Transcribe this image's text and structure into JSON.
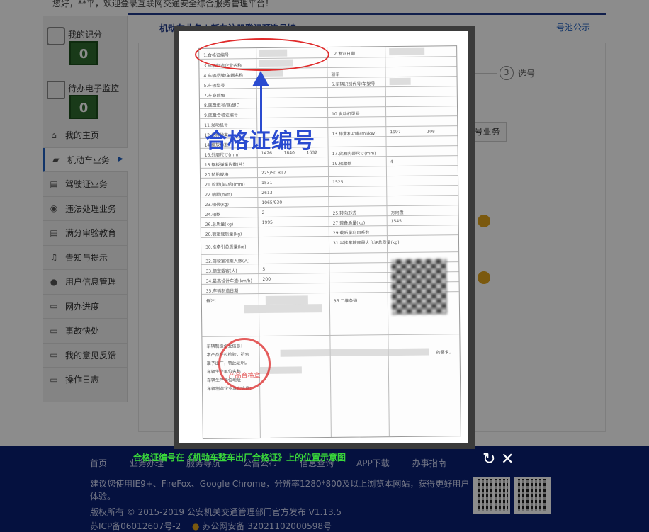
{
  "header": {
    "greeting": "您好，**平，欢迎登录互联网交通安全综合服务管理平台！"
  },
  "sidebar": {
    "stats": [
      {
        "label": "我的记分",
        "count": "0",
        "icon": "score-icon"
      },
      {
        "label": "待办电子监控",
        "count": "0",
        "icon": "camera-icon"
      }
    ],
    "items": [
      {
        "label": "我的主页",
        "icon": "home-icon"
      },
      {
        "label": "机动车业务",
        "icon": "truck-icon",
        "active": true
      },
      {
        "label": "驾驶证业务",
        "icon": "license-icon"
      },
      {
        "label": "违法处理业务",
        "icon": "camera-icon"
      },
      {
        "label": "满分审验教育",
        "icon": "list-icon"
      },
      {
        "label": "告知与提示",
        "icon": "bell-icon"
      },
      {
        "label": "用户信息管理",
        "icon": "user-icon"
      },
      {
        "label": "网办进度",
        "icon": "progress-icon"
      },
      {
        "label": "事故快处",
        "icon": "accident-icon"
      },
      {
        "label": "我的意见反馈",
        "icon": "feedback-icon"
      },
      {
        "label": "操作日志",
        "icon": "log-icon"
      }
    ]
  },
  "main": {
    "tab_title": "机动车业务 | 新车注册登记预选号牌",
    "tab_right": "号池公示",
    "step_num": "3",
    "step_label": "选号",
    "biz_button": "号业务"
  },
  "modal": {
    "callout": "合格证编号",
    "seal_text": "产品合格章",
    "caption": "合格证编号在《机动车整车出厂合格证》上的位置示意图",
    "doc_fields": {
      "f1": "1.合格证编号",
      "f2": "2.发证日期",
      "f3": "3.车辆制造企业名称",
      "f4": "4.车辆品牌/车辆名称",
      "f4v": "轿车",
      "f5": "5.车辆型号",
      "f6": "6.车辆识别代号/车架号",
      "f7": "7.车身颜色",
      "f8": "8.底盘型号/底盘ID",
      "f9": "9.底盘合格证编号",
      "f10": "10.发动机型号",
      "f11": "11.发动机号",
      "f12": "12.燃料种类",
      "f13": "13.排量和功率(ml/kW)",
      "f13v1": "1997",
      "f13v2": "108",
      "f14": "14.排放标准",
      "f16": "16.外廓尺寸(mm)",
      "f16v1": "1426",
      "f16v2": "1840",
      "f16v3": "1632",
      "f17": "17.货厢内部尺寸(mm)",
      "f18": "18.钢板弹簧片数(片)",
      "f19": "19.轮胎数",
      "f19v": "4",
      "f20": "20.轮胎规格",
      "f20v": "225/50 R17",
      "f21": "21.轮距(前/后)(mm)",
      "f21v1": "1531",
      "f21v2": "1525",
      "f22": "22.轴距(mm)",
      "f22v": "2613",
      "f23": "23.轴荷(kg)",
      "f23v": "1065/930",
      "f24": "24.轴数",
      "f24v": "2",
      "f25": "25.转向形式",
      "f25v": "方向盘",
      "f26": "26.总质量(kg)",
      "f26v": "1995",
      "f27": "27.整备质量(kg)",
      "f27v": "1545",
      "f28": "28.额定载质量(kg)",
      "f29": "29.载质量利用系数",
      "f30": "30.准牵引总质量(kg)",
      "f31": "31.半挂车鞍座最大允许总质量(kg)",
      "f32": "32.驾驶室准乘人数(人)",
      "f33": "33.额定载客(人)",
      "f33v": "5",
      "f34": "34.最高设计车速(km/h)",
      "f34v": "200",
      "f35": "35.车辆制造日期",
      "f36": "36.二维条码",
      "note": "备注：",
      "cert1": "车辆制造企业信息：",
      "cert2": "本产品经过检验，符合",
      "cert3": "的要求，",
      "cert4": "准予出厂，特此证明。",
      "cert5": "车辆生产单位名称：",
      "cert6": "车辆生产单位地址：",
      "cert7": "车辆制造企业其它信息："
    }
  },
  "footer": {
    "links": [
      "首页",
      "业务办理",
      "服务导航",
      "公告公布",
      "信息查询",
      "APP下载",
      "办事指南"
    ],
    "browser_note": "建议您使用IE9+、FireFox、Google Chrome，分辨率1280*800及以上浏览本网站，获得更好用户体验。",
    "copyright": "版权所有 © 2015-2019 公安机关交通管理部门官方发布 V1.13.5",
    "icp": "苏ICP备06012607号-2",
    "police": "苏公网安备 32021102000598号"
  },
  "colors": {
    "footer_bg": "#0a1f73",
    "accent": "#1f3a8a",
    "callout": "#2a4bd0",
    "highlight": "#e02b2b",
    "caption": "#39d63a"
  }
}
